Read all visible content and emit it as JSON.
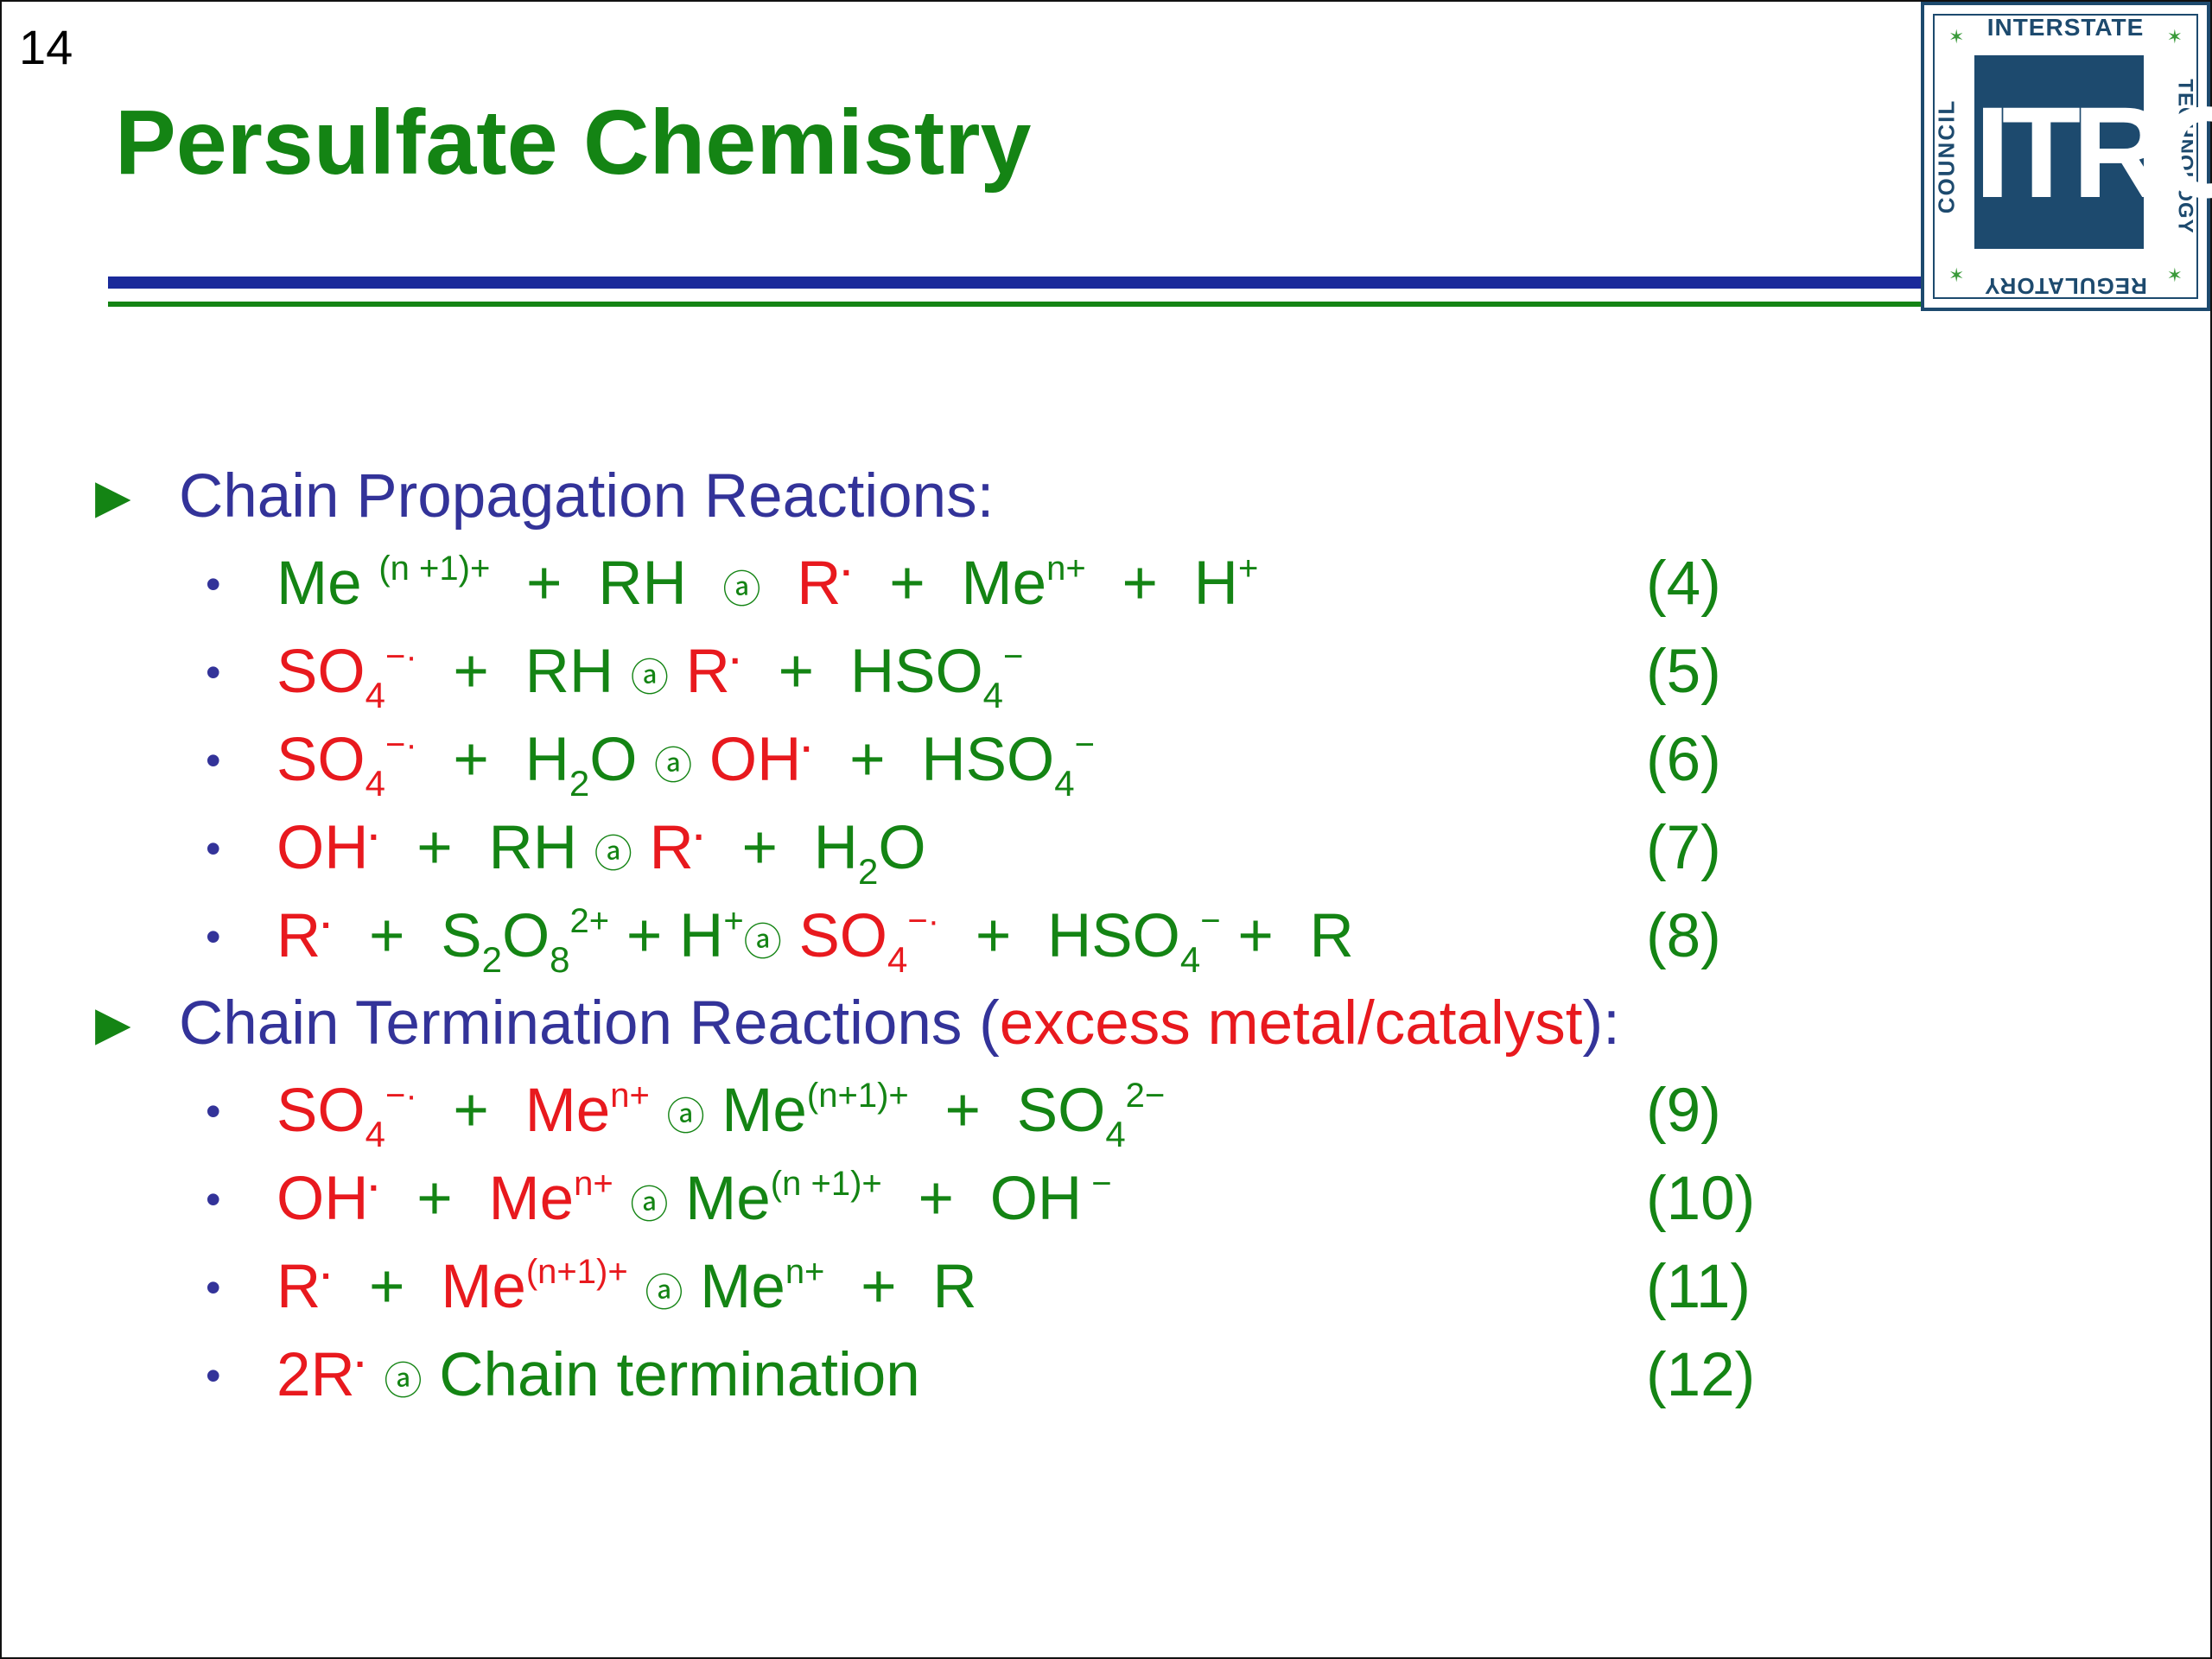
{
  "slide_number": "14",
  "title": "Persulfate Chemistry",
  "logo": {
    "top": "INTERSTATE",
    "right": "TECHNOLOGY",
    "bottom": "REGULATORY",
    "left": "COUNCIL",
    "mark": "ITRC"
  },
  "section1": {
    "heading": "Chain Propagation Reactions:",
    "numbers": [
      "(4)",
      "(5)",
      "(6)",
      "(7)",
      "(8)"
    ]
  },
  "section2": {
    "heading_start": "Chain Termination Reactions (",
    "heading_highlight": "excess metal/catalyst",
    "heading_end": "):",
    "numbers": [
      "(9)",
      "(10)",
      "(11)",
      "(12)"
    ]
  },
  "eq12_text": "Chain termination",
  "colors": {
    "title": "#148414",
    "heading": "#333399",
    "radical": "#e8191e",
    "rule_blue": "#1a2a9a",
    "logo": "#1d4a6e"
  }
}
